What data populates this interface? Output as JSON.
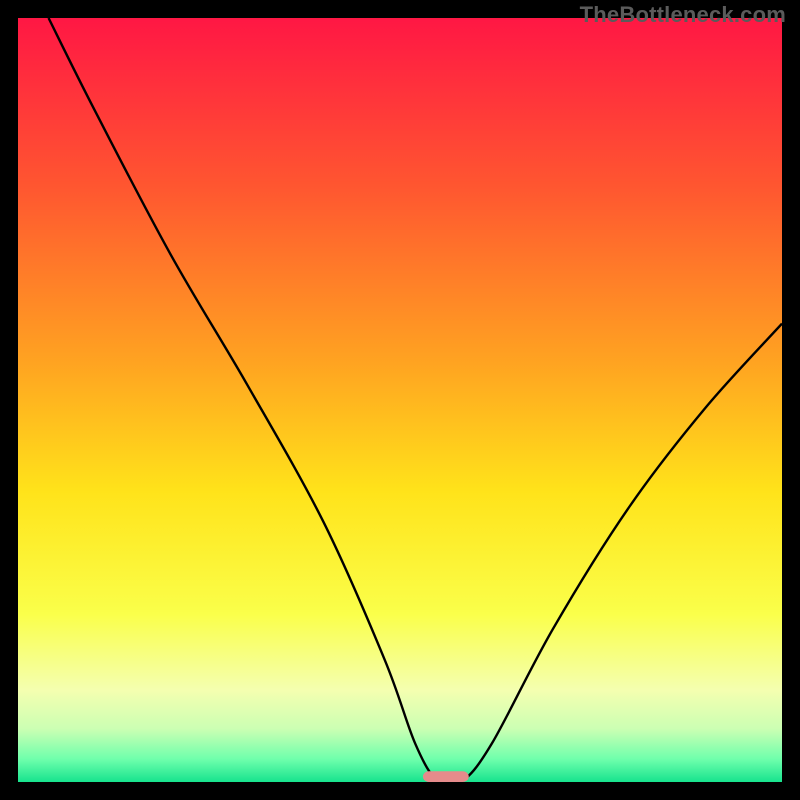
{
  "watermark": "TheBottleneck.com",
  "chart_data": {
    "type": "line",
    "title": "",
    "xlabel": "",
    "ylabel": "",
    "xlim": [
      0,
      100
    ],
    "ylim": [
      0,
      100
    ],
    "series": [
      {
        "name": "curve",
        "x": [
          4,
          10,
          20,
          30,
          40,
          48,
          52,
          55,
          58,
          62,
          70,
          80,
          90,
          100
        ],
        "y": [
          100,
          88,
          69,
          52,
          34,
          16,
          5,
          0,
          0,
          5,
          20,
          36,
          49,
          60
        ]
      }
    ],
    "marker": {
      "x": 56,
      "y": 0,
      "width": 6,
      "height": 1.4,
      "color": "#e58b8b"
    },
    "gradient_stops": [
      {
        "offset": 0,
        "color": "#ff1744"
      },
      {
        "offset": 22,
        "color": "#ff5630"
      },
      {
        "offset": 45,
        "color": "#ffa321"
      },
      {
        "offset": 62,
        "color": "#ffe31a"
      },
      {
        "offset": 78,
        "color": "#faff4a"
      },
      {
        "offset": 88,
        "color": "#f4ffb0"
      },
      {
        "offset": 93,
        "color": "#ccffb3"
      },
      {
        "offset": 97,
        "color": "#6fffac"
      },
      {
        "offset": 100,
        "color": "#17e38e"
      }
    ]
  }
}
